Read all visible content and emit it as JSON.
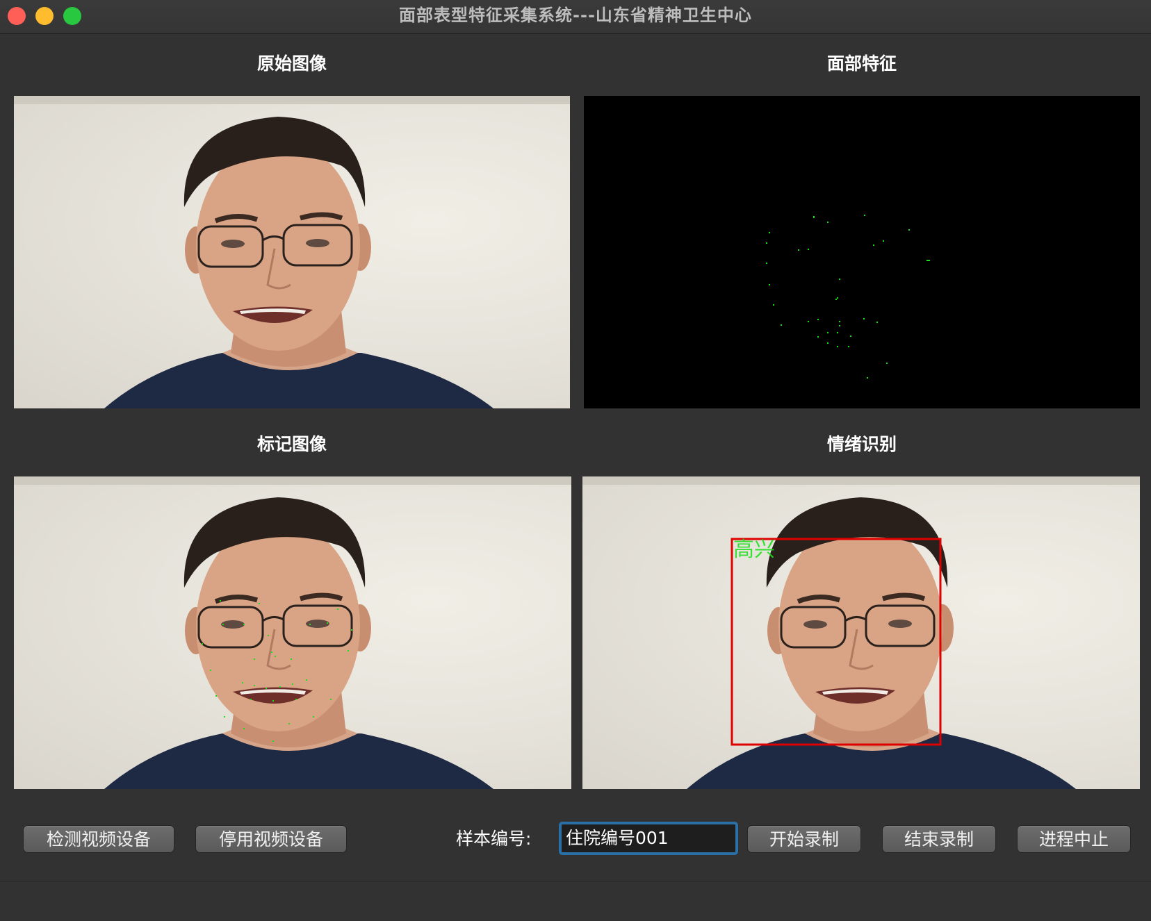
{
  "window": {
    "title": "面部表型特征采集系统---山东省精神卫生中心"
  },
  "panels": {
    "original": {
      "title": "原始图像"
    },
    "features": {
      "title": "面部特征"
    },
    "marked": {
      "title": "标记图像"
    },
    "emotion": {
      "title": "情绪识别",
      "overlay_label": "高兴",
      "box_color": "#e00000"
    }
  },
  "controls": {
    "detect_button": "检测视频设备",
    "disable_button": "停用视频设备",
    "sample_label": "样本编号:",
    "sample_value": "住院编号001",
    "start_button": "开始录制",
    "stop_button": "结束录制",
    "abort_button": "进程中止"
  },
  "colors": {
    "landmark": "#19e019",
    "emotion_box": "#e00000",
    "input_focus": "#2a6fa6"
  }
}
